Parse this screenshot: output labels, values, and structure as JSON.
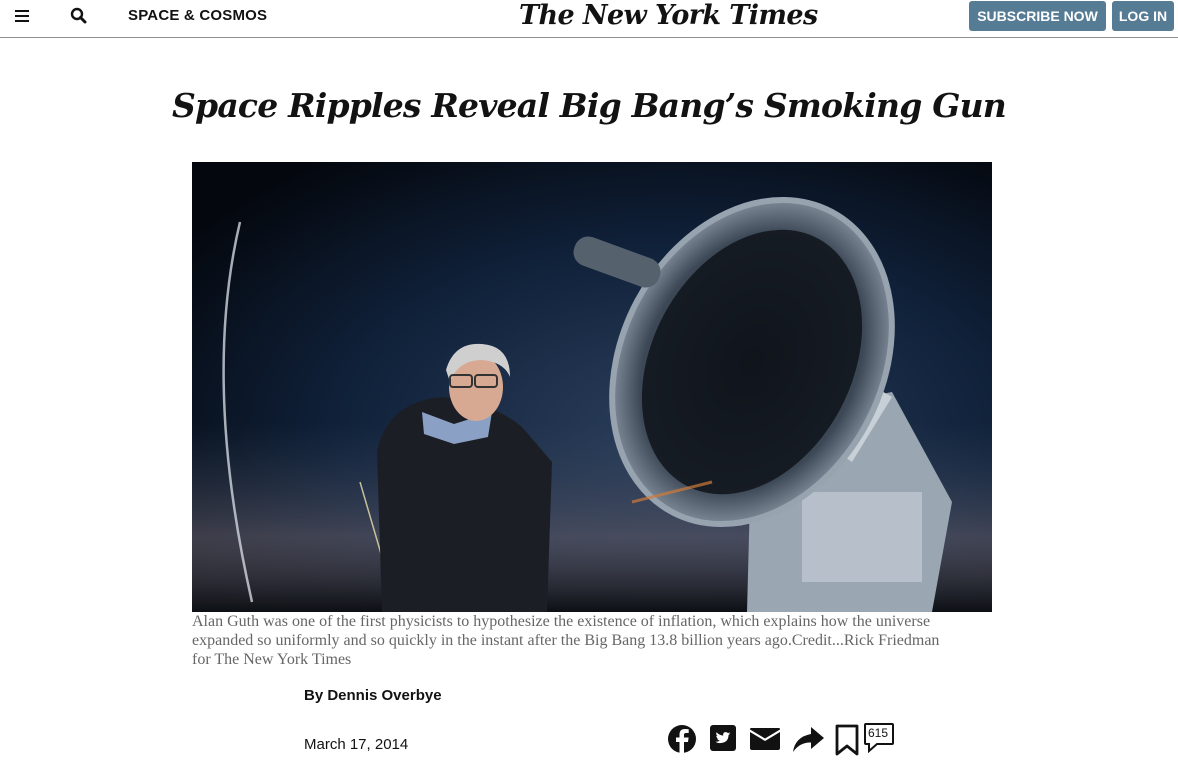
{
  "header": {
    "menu_icon": "hamburger-icon",
    "search_icon": "search-icon",
    "section_label": "SPACE & COSMOS",
    "logo_text": "The New York Times",
    "subscribe_label": "SUBSCRIBE NOW",
    "login_label": "LOG IN",
    "accent_color": "#567b95"
  },
  "article": {
    "headline": "Space Ripples Reveal Big Bang’s Smoking Gun",
    "caption": "Alan Guth was one of the first physicists to hypothesize the existence of inflation, which explains how the universe expanded so uniformly and so quickly in the instant after the Big Bang 13.8 billion years ago.Credit...Rick Friedman for The New York Times",
    "byline": "By Dennis Overbye",
    "date": "March 17, 2014"
  },
  "share": {
    "icons": [
      "facebook-icon",
      "twitter-icon",
      "email-icon",
      "share-icon",
      "bookmark-icon",
      "comment-icon"
    ],
    "comment_count": "615"
  }
}
